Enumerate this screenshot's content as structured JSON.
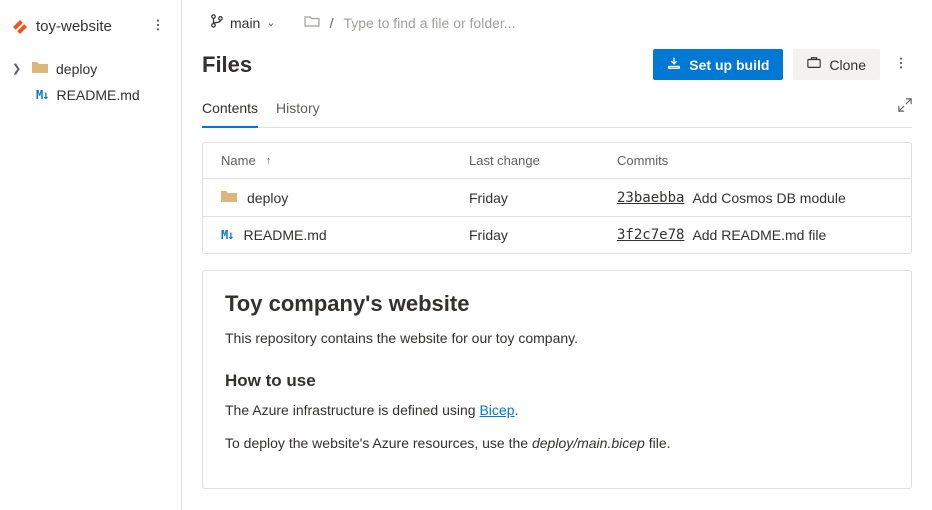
{
  "sidebar": {
    "repo_name": "toy-website",
    "tree": {
      "folder": "deploy",
      "file": "README.md"
    }
  },
  "topbar": {
    "branch": "main",
    "search_placeholder": "Type to find a file or folder..."
  },
  "page": {
    "title": "Files"
  },
  "actions": {
    "setup_build": "Set up build",
    "clone": "Clone"
  },
  "tabs": {
    "contents": "Contents",
    "history": "History"
  },
  "table": {
    "headers": {
      "name": "Name",
      "last_change": "Last change",
      "commits": "Commits"
    },
    "rows": [
      {
        "type": "folder",
        "name": "deploy",
        "last_change": "Friday",
        "hash": "23baebba",
        "message": "Add Cosmos DB module"
      },
      {
        "type": "md",
        "name": "README.md",
        "last_change": "Friday",
        "hash": "3f2c7e78",
        "message": "Add README.md file"
      }
    ]
  },
  "readme": {
    "h1": "Toy company's website",
    "p1": "This repository contains the website for our toy company.",
    "h2": "How to use",
    "p2_pre": "The Azure infrastructure is defined using ",
    "p2_link": "Bicep",
    "p2_post": ".",
    "p3_pre": "To deploy the website's Azure resources, use the ",
    "p3_em": "deploy/main.bicep",
    "p3_post": " file."
  }
}
